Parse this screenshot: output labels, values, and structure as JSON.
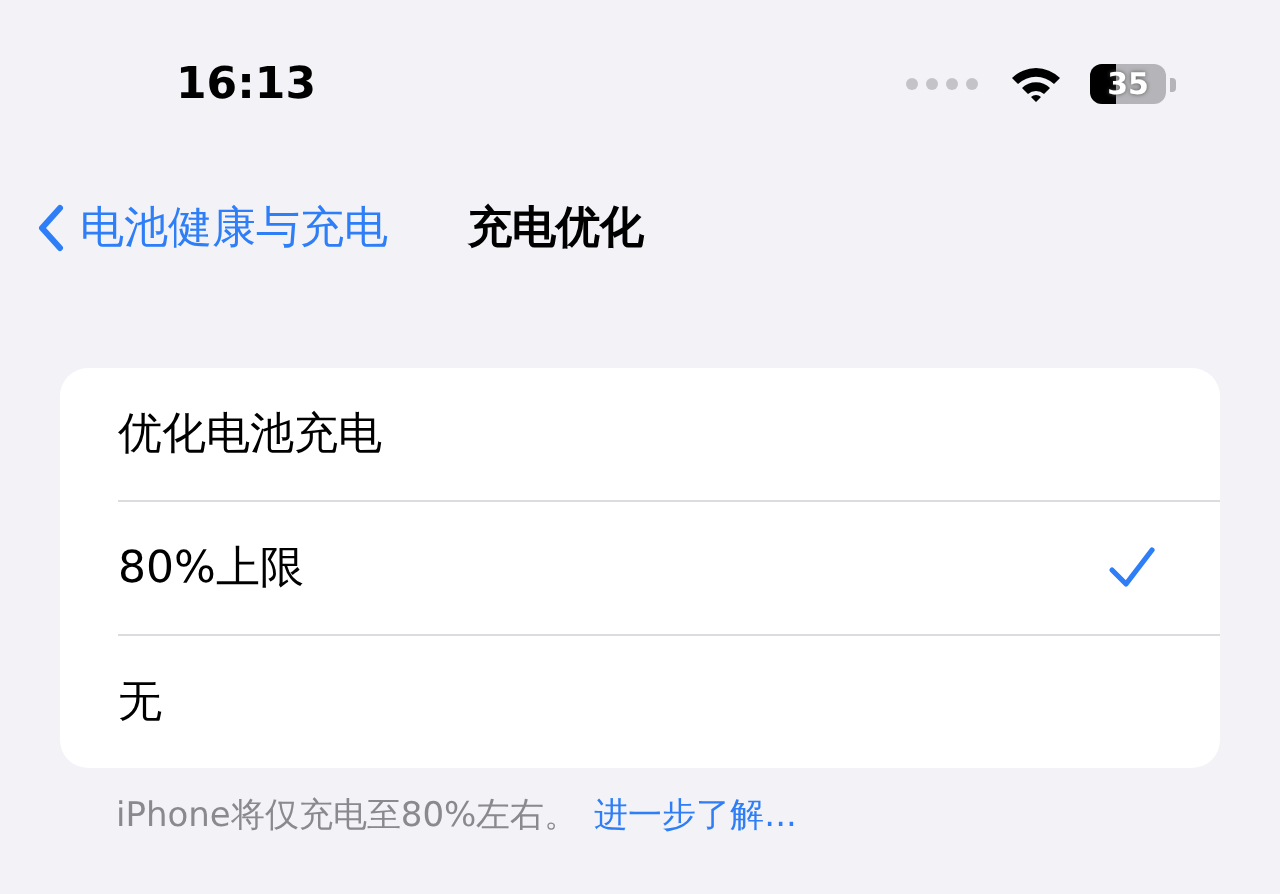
{
  "status_bar": {
    "time": "16:13",
    "battery": "35"
  },
  "nav": {
    "back": "电池健康与充电",
    "title": "充电优化"
  },
  "options": [
    {
      "label": "优化电池充电",
      "selected": false
    },
    {
      "label": "80%上限",
      "selected": true
    },
    {
      "label": "无",
      "selected": false
    }
  ],
  "footer": {
    "text": "iPhone将仅充电至80%左右。",
    "link": "进一步了解..."
  }
}
